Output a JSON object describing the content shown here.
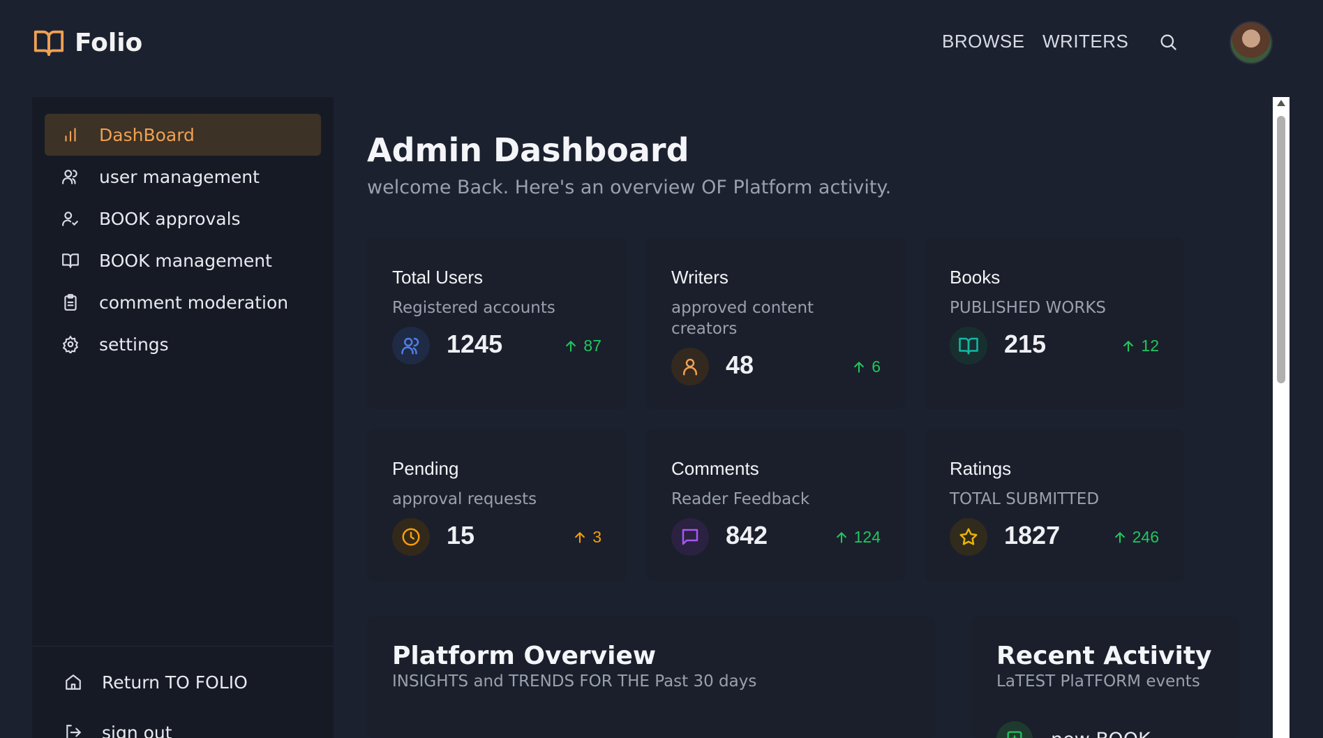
{
  "brand": {
    "name": "Folio",
    "color": "#f0a053"
  },
  "nav": {
    "browse": "BROWSE",
    "writers": "WRITERS"
  },
  "sidebar": {
    "items": [
      {
        "label": "DashBoard",
        "icon": "bar-chart-icon",
        "active": true
      },
      {
        "label": "user management",
        "icon": "users-icon"
      },
      {
        "label": "BOOK approvals",
        "icon": "user-check-icon"
      },
      {
        "label": "BOOK management",
        "icon": "book-icon"
      },
      {
        "label": "comment moderation",
        "icon": "clipboard-icon"
      },
      {
        "label": "settings",
        "icon": "gear-icon"
      }
    ],
    "bottom": [
      {
        "label": "Return TO FOLIO",
        "icon": "home-icon"
      },
      {
        "label": "sign out",
        "icon": "logout-icon"
      }
    ]
  },
  "main": {
    "title": "Admin Dashboard",
    "subtitle": "welcome Back. Here's an overview OF Platform activity."
  },
  "stats": [
    {
      "title": "Total Users",
      "subtitle": "Registered accounts",
      "value": "1245",
      "delta": "87",
      "icon": "users-icon",
      "icon_color": "#4f7fe6",
      "icon_bg": "#1f2a45",
      "delta_color": "#22c55e"
    },
    {
      "title": "Writers",
      "subtitle": "approved content creators",
      "value": "48",
      "delta": "6",
      "icon": "user-icon",
      "icon_color": "#f0a053",
      "icon_bg": "#33291f",
      "delta_color": "#22c55e"
    },
    {
      "title": "Books",
      "subtitle": "PUBLISHED WORKS",
      "value": "215",
      "delta": "12",
      "icon": "book-icon",
      "icon_color": "#14b8a6",
      "icon_bg": "#17302f",
      "delta_color": "#22c55e"
    },
    {
      "title": "Pending",
      "subtitle": "approval requests",
      "value": "15",
      "delta": "3",
      "icon": "clock-icon",
      "icon_color": "#f59e0b",
      "icon_bg": "#33291a",
      "delta_color": "#f59e0b"
    },
    {
      "title": "Comments",
      "subtitle": "Reader Feedback",
      "value": "842",
      "delta": "124",
      "icon": "message-icon",
      "icon_color": "#a855f7",
      "icon_bg": "#2a2240",
      "delta_color": "#22c55e"
    },
    {
      "title": "Ratings",
      "subtitle": "TOTAL SUBMITTED",
      "value": "1827",
      "delta": "246",
      "icon": "star-icon",
      "icon_color": "#eab308",
      "icon_bg": "#302b1c",
      "delta_color": "#22c55e"
    }
  ],
  "overview": {
    "title": "Platform Overview",
    "subtitle": "INSIGHTS and TRENDS FOR THE Past 30 days"
  },
  "activity": {
    "title": "Recent Activity",
    "subtitle": "LaTEST PlaTFORM events",
    "first_item": "new BOOK"
  }
}
